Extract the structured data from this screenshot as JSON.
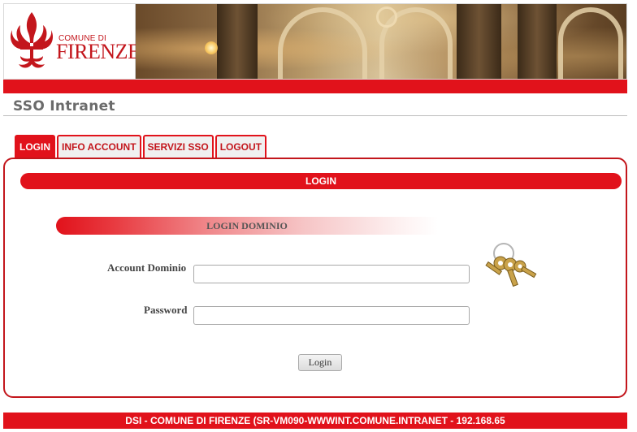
{
  "header": {
    "logo_line1": "COMUNE DI",
    "logo_line2": "FIRENZE",
    "brand_color": "#e1121b"
  },
  "page_title": "SSO Intranet",
  "tabs": [
    {
      "label": "LOGIN",
      "active": true
    },
    {
      "label": "INFO ACCOUNT",
      "active": false
    },
    {
      "label": "SERVIZI SSO",
      "active": false
    },
    {
      "label": "LOGOUT",
      "active": false
    }
  ],
  "panel": {
    "header": "LOGIN",
    "section_title": "LOGIN DOMINIO",
    "account_label": "Account Dominio",
    "account_value": "",
    "password_label": "Password",
    "password_value": "",
    "submit_label": "Login",
    "keys_icon": "keys-icon"
  },
  "footer": {
    "text": "DSI - COMUNE DI FIRENZE (SR-VM090-WWWINT.COMUNE.INTRANET - 192.168.65"
  }
}
